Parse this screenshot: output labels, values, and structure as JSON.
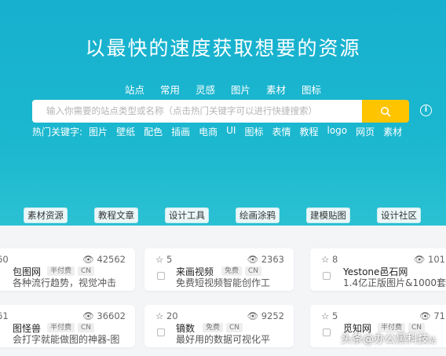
{
  "hero": {
    "headline": "以最快的速度获取想要的资源",
    "tabs": [
      "站点",
      "常用",
      "灵感",
      "图片",
      "素材",
      "图标"
    ],
    "search_placeholder": "输入你需要的站点类型或名称（点击热门关键字可以进行快捷搜索）",
    "hot_label": "热门关键字:",
    "hot_keywords": [
      "图片",
      "壁纸",
      "配色",
      "插画",
      "电商",
      "UI",
      "图标",
      "表情",
      "教程",
      "logo",
      "网页",
      "素材"
    ]
  },
  "categories": [
    "素材资源",
    "教程文章",
    "设计工具",
    "绘画涂鸦",
    "建模贴图",
    "设计社区"
  ],
  "cards": [
    {
      "fav": "60",
      "views": "42562",
      "name": "包图网",
      "tags": [
        "半付费",
        "CN"
      ],
      "desc": "各种流行趋势，视觉冲击"
    },
    {
      "fav": "5",
      "views": "2363",
      "name": "来画视频",
      "tags": [
        "免费",
        "CN"
      ],
      "desc": "免费短视频智能创作工"
    },
    {
      "fav": "8",
      "views": "101",
      "name": "Yestone邑石网",
      "tags": [
        "半付费",
        "CN"
      ],
      "desc": "1.4亿正版图片&1000套"
    },
    {
      "fav": "61",
      "views": "36602",
      "name": "图怪兽",
      "tags": [
        "半付费",
        "CN"
      ],
      "desc": "会打字就能做图的神器-图"
    },
    {
      "fav": "20",
      "views": "9252",
      "name": "镝数",
      "tags": [
        "免费",
        "CN"
      ],
      "desc": "最好用的数据可视化平"
    },
    {
      "fav": "5",
      "views": "71",
      "name": "觅知网",
      "tags": [
        "半付费",
        "CN"
      ],
      "desc": ""
    }
  ],
  "watermark": {
    "text": "头条@办公黑科技",
    "sub": "站"
  },
  "colors": {
    "hero": "#1bb7cf",
    "search_button": "#ffc400"
  },
  "icons": {
    "search": "search-icon",
    "info": "info-icon",
    "star": "star-icon",
    "eye": "eye-icon"
  }
}
